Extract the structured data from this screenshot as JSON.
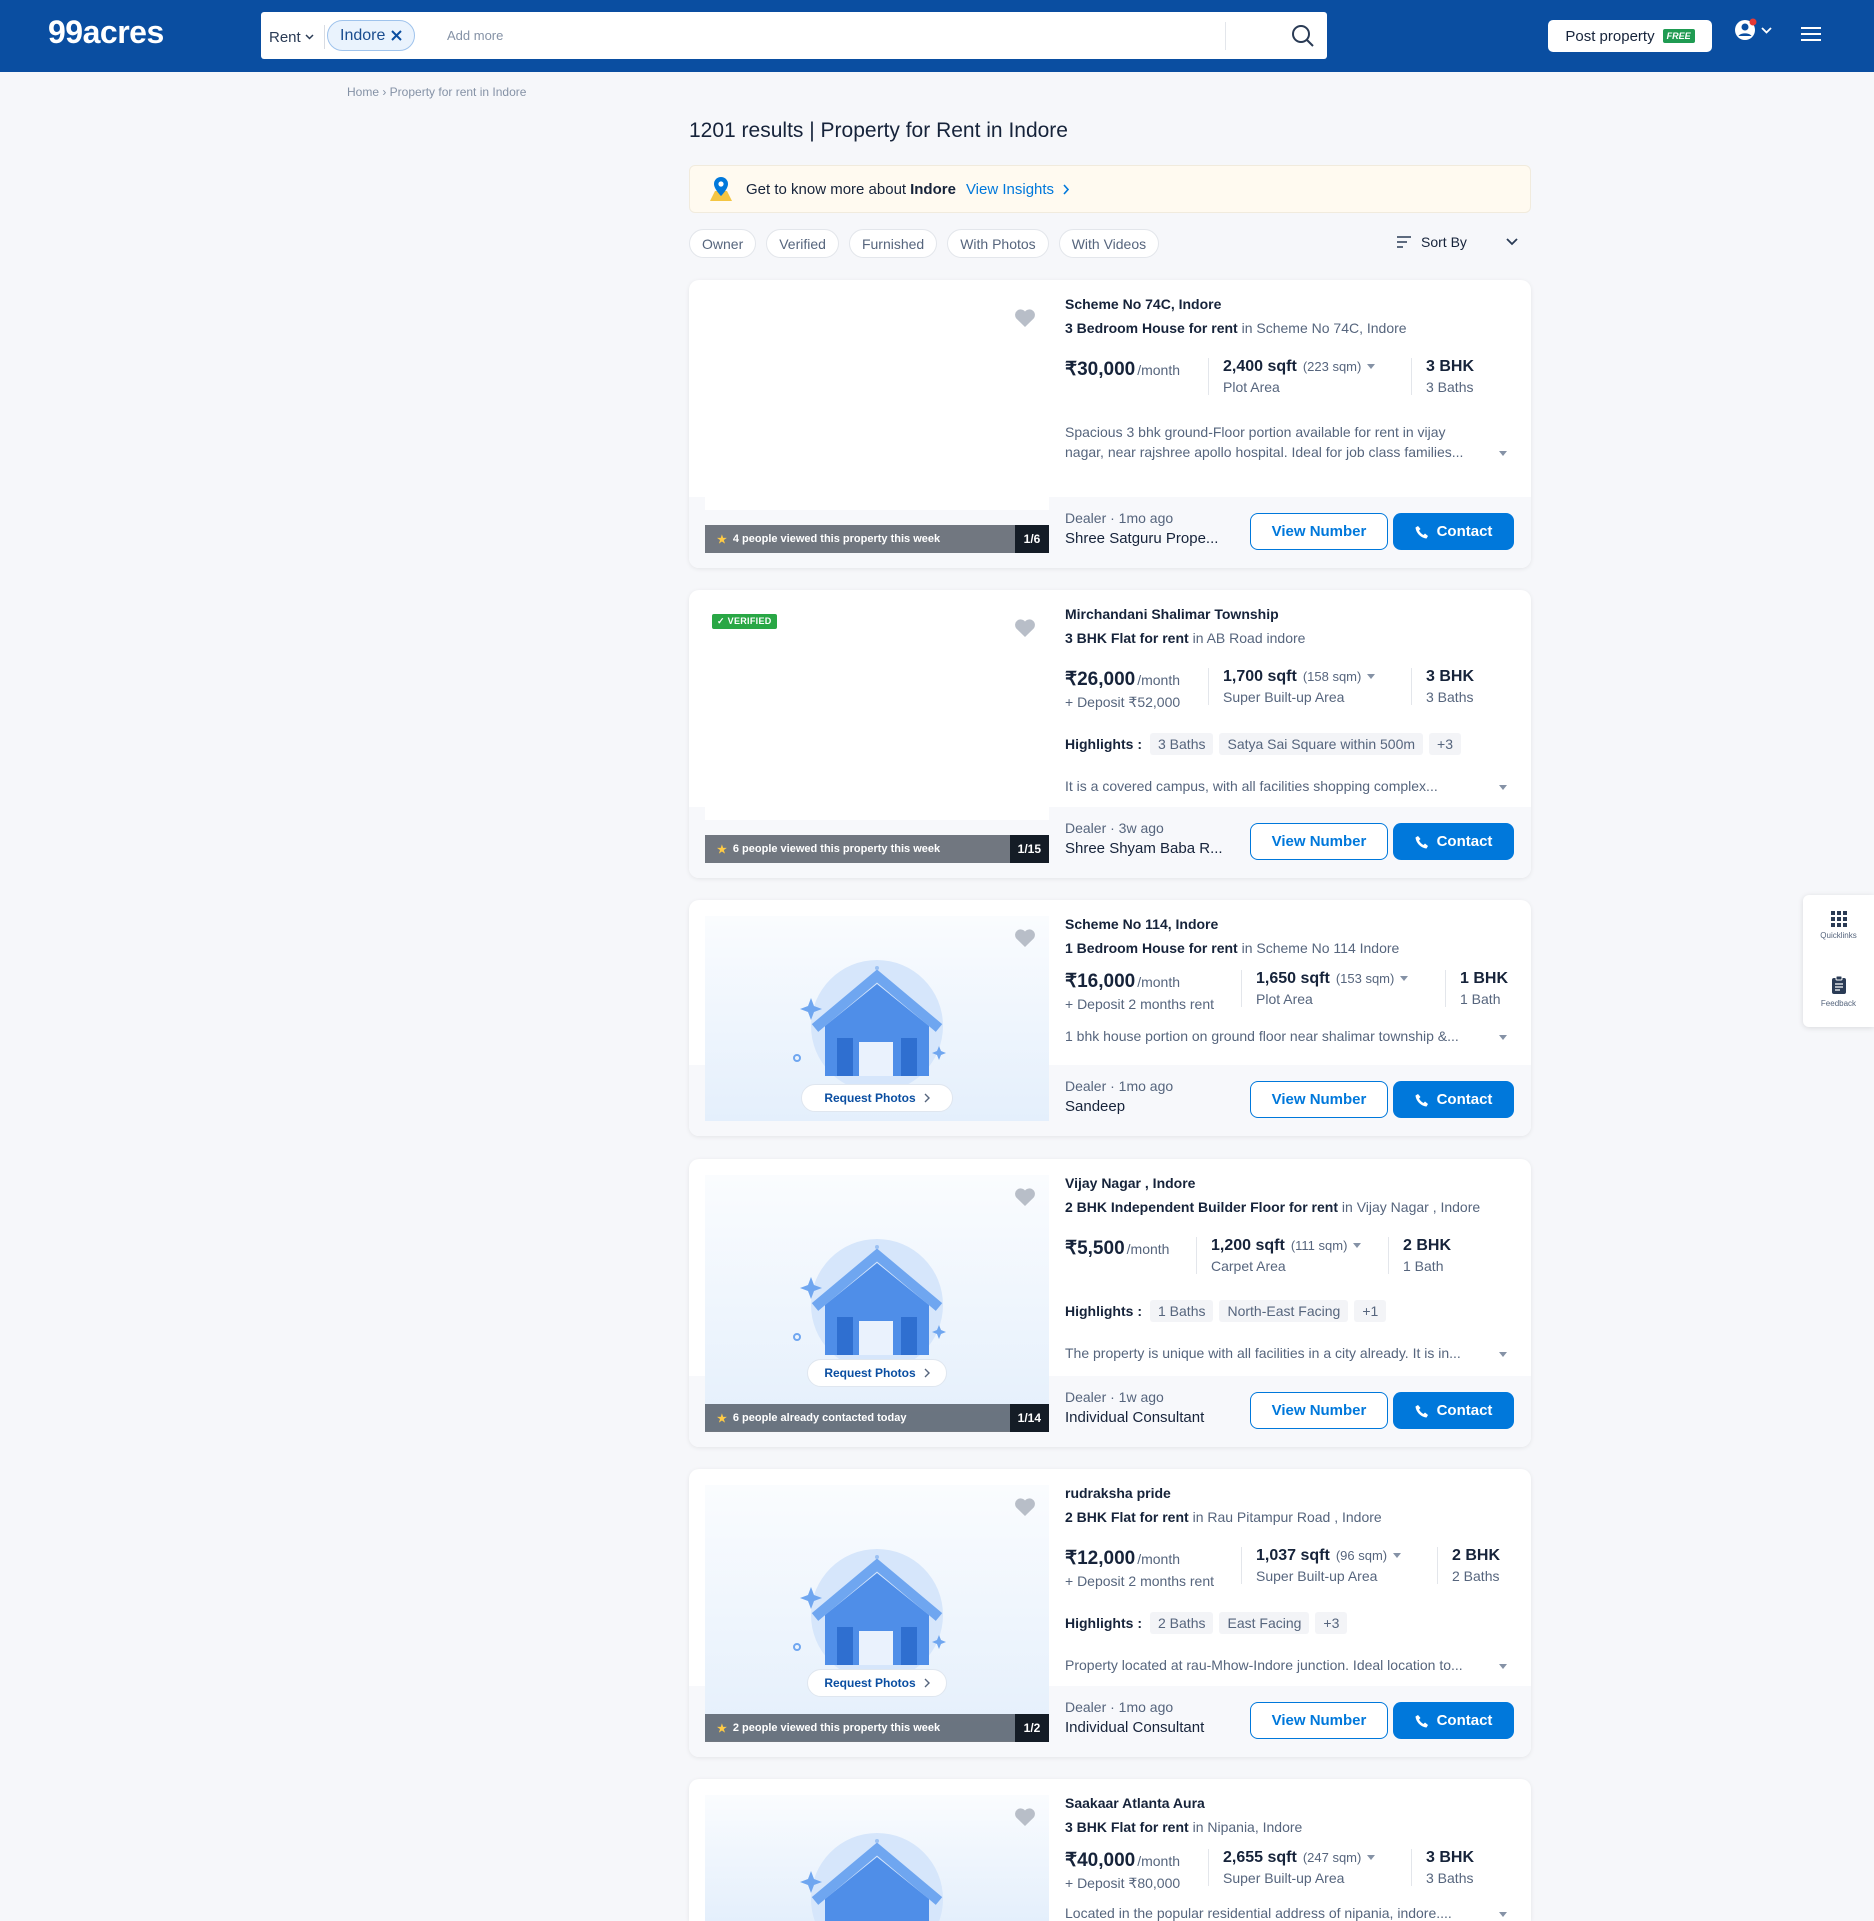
{
  "header": {
    "logo": "99acres",
    "search": {
      "mode": "Rent",
      "city_chip": "Indore",
      "placeholder": "Add more"
    },
    "post_property": {
      "label": "Post property",
      "badge": "FREE"
    },
    "icons": [
      "search-icon",
      "user-icon",
      "chevron-down-icon",
      "hamburger-icon"
    ]
  },
  "breadcrumb": "Home › Property for rent in Indore",
  "results_heading": "1201 results | Property for Rent in Indore",
  "insight_banner": {
    "text": "Get to know more about",
    "city": "Indore",
    "link": "View Insights"
  },
  "filters": [
    "Owner",
    "Verified",
    "Furnished",
    "With Photos",
    "With Videos"
  ],
  "sort_label": "Sort By",
  "listings": [
    {
      "title": "Scheme No 74C, Indore",
      "type": "3 Bedroom House for rent",
      "location_suffix": "in Scheme No 74C, Indore",
      "price": "₹30,000",
      "per": "/month",
      "deposit": "",
      "area": "2,400 sqft",
      "area_sqm": "(223 sqm)",
      "area_type": "Plot Area",
      "bhk": "3 BHK",
      "baths": "3 Baths",
      "highlights": [],
      "description": "Spacious 3 bhk ground-Floor portion available for rent in vijay nagar, near rajshree apollo hospital. Ideal for job class families...",
      "views_text": "4 people viewed this property this week",
      "photo_count": "1/6",
      "dealer_meta": "Dealer · 1mo ago",
      "dealer_name": "Shree Satguru Prope...",
      "verified": false,
      "request_photos": false
    },
    {
      "title": "Mirchandani Shalimar Township",
      "type": "3 BHK Flat for rent",
      "location_suffix": "in AB Road indore",
      "price": "₹26,000",
      "per": "/month",
      "deposit": "+ Deposit ₹52,000",
      "area": "1,700 sqft",
      "area_sqm": "(158 sqm)",
      "area_type": "Super Built-up Area",
      "bhk": "3 BHK",
      "baths": "3 Baths",
      "highlights": [
        "3 Baths",
        "Satya Sai Square within 500m",
        "+3"
      ],
      "description": "It is a covered campus, with all facilities shopping complex...",
      "views_text": "6 people viewed this property this week",
      "photo_count": "1/15",
      "dealer_meta": "Dealer · 3w ago",
      "dealer_name": "Shree Shyam Baba R...",
      "verified": true,
      "verified_label": "VERIFIED",
      "request_photos": false
    },
    {
      "title": "Scheme No 114, Indore",
      "type": "1 Bedroom House for rent",
      "location_suffix": "in Scheme No 114 Indore",
      "price": "₹16,000",
      "per": "/month",
      "deposit": "+ Deposit 2 months rent",
      "area": "1,650 sqft",
      "area_sqm": "(153 sqm)",
      "area_type": "Plot Area",
      "bhk": "1 BHK",
      "baths": "1 Bath",
      "highlights": [],
      "description": "1 bhk house portion on ground floor near shalimar township &...",
      "views_text": "",
      "photo_count": "",
      "dealer_meta": "Dealer · 1mo ago",
      "dealer_name": "Sandeep",
      "verified": false,
      "request_photos": true
    },
    {
      "title": "Vijay Nagar , Indore",
      "type": "2 BHK Independent Builder Floor for rent",
      "location_suffix": "in Vijay Nagar , Indore",
      "price": "₹5,500",
      "per": "/month",
      "deposit": "",
      "area": "1,200 sqft",
      "area_sqm": "(111 sqm)",
      "area_type": "Carpet Area",
      "bhk": "2 BHK",
      "baths": "1 Bath",
      "highlights": [
        "1 Baths",
        "North-East Facing",
        "+1"
      ],
      "description": "The property is unique with all facilities in a city already. It is in...",
      "views_text": "6 people already contacted today",
      "photo_count": "1/14",
      "dealer_meta": "Dealer · 1w ago",
      "dealer_name": "Individual Consultant",
      "verified": false,
      "request_photos": true
    },
    {
      "title": "rudraksha pride",
      "type": "2 BHK Flat for rent",
      "location_suffix": "in Rau Pitampur Road , Indore",
      "price": "₹12,000",
      "per": "/month",
      "deposit": "+ Deposit 2 months rent",
      "area": "1,037 sqft",
      "area_sqm": "(96 sqm)",
      "area_type": "Super Built-up Area",
      "bhk": "2 BHK",
      "baths": "2 Baths",
      "highlights": [
        "2 Baths",
        "East Facing",
        "+3"
      ],
      "description": "Property located at rau-Mhow-Indore junction. Ideal location to...",
      "views_text": "2 people viewed this property this week",
      "photo_count": "1/2",
      "dealer_meta": "Dealer · 1mo ago",
      "dealer_name": "Individual Consultant",
      "verified": false,
      "request_photos": true
    },
    {
      "title": "Saakaar Atlanta Aura",
      "type": "3 BHK Flat for rent",
      "location_suffix": "in Nipania, Indore",
      "price": "₹40,000",
      "per": "/month",
      "deposit": "+ Deposit ₹80,000",
      "area": "2,655 sqft",
      "area_sqm": "(247 sqm)",
      "area_type": "Super Built-up Area",
      "bhk": "3 BHK",
      "baths": "3 Baths",
      "highlights": [],
      "description": "Located in the popular residential address of nipania, indore....",
      "views_text": "",
      "photo_count": "",
      "dealer_meta": "",
      "dealer_name": "",
      "verified": false,
      "request_photos": true
    }
  ],
  "buttons": {
    "view_number": "View Number",
    "contact": "Contact",
    "request_photos": "Request Photos"
  },
  "side_panel": {
    "quicklinks": "Quicklinks",
    "feedback": "Feedback"
  }
}
